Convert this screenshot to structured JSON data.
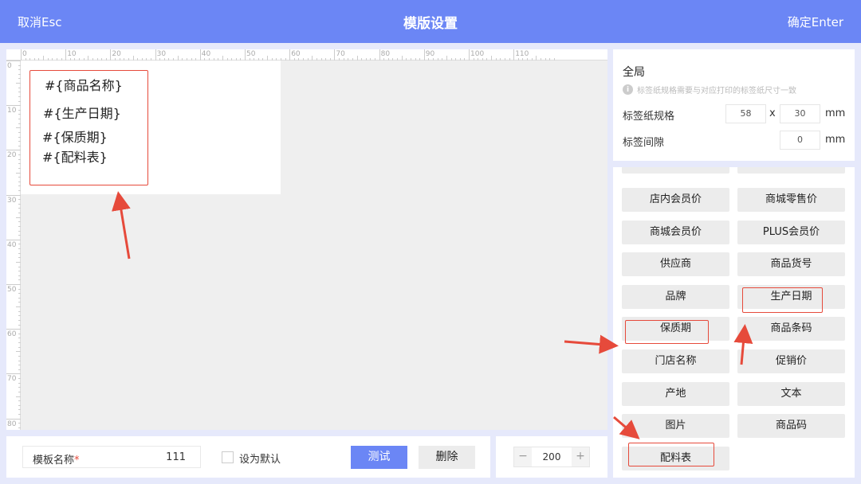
{
  "header": {
    "cancel": "取消Esc",
    "title": "模版设置",
    "confirm": "确定Enter"
  },
  "ruler": {
    "top_labels": [
      "0",
      "10",
      "20",
      "30",
      "40",
      "50",
      "60",
      "70",
      "80",
      "90",
      "100",
      "110"
    ],
    "left_labels": [
      "0",
      "10",
      "20",
      "30",
      "40",
      "50",
      "60",
      "70",
      "80"
    ]
  },
  "label_fields": [
    "#{商品名称}",
    "#{生产日期}",
    "#{保质期}",
    "#{配料表}"
  ],
  "global": {
    "title": "全局",
    "tip": "标签纸规格需要与对应打印的标签纸尺寸一致",
    "size_label": "标签纸规格",
    "width": "58",
    "times": "x",
    "height": "30",
    "unit": "mm",
    "gap_label": "标签间隙",
    "gap": "0"
  },
  "field_buttons": [
    "店内会员价",
    "商城零售价",
    "商城会员价",
    "PLUS会员价",
    "供应商",
    "商品货号",
    "品牌",
    "生产日期",
    "保质期",
    "商品条码",
    "门店名称",
    "促销价",
    "产地",
    "文本",
    "图片",
    "商品码",
    "配料表"
  ],
  "bottom": {
    "name_label": "模板名称",
    "required_mark": "*",
    "name_value": "111",
    "default_label": "设为默认",
    "test": "测试",
    "delete": "删除"
  },
  "zoom": {
    "minus": "−",
    "value": "200",
    "plus": "+"
  }
}
